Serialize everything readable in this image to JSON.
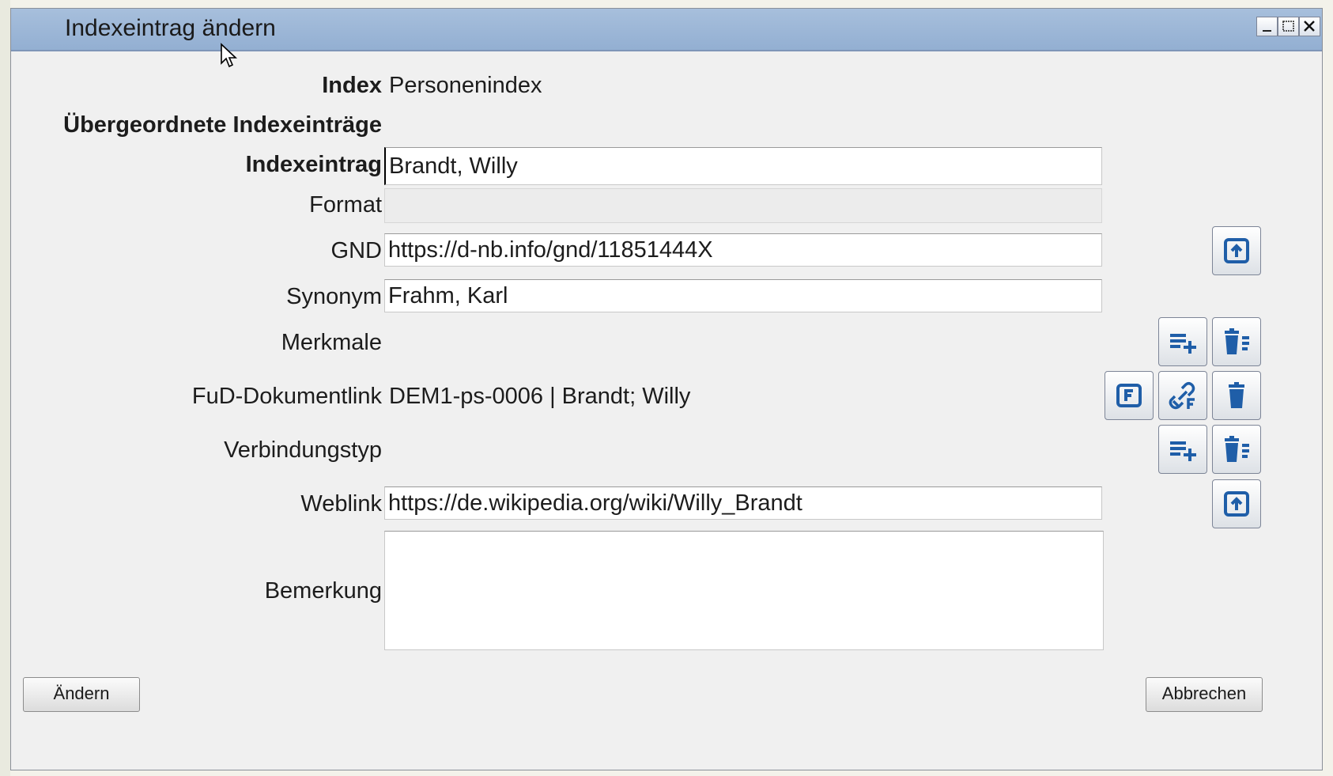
{
  "window": {
    "title": "Indexeintrag ändern"
  },
  "form": {
    "index": {
      "label": "Index",
      "value": "Personenindex"
    },
    "parent_heading": "Übergeordnete Indexeinträge",
    "entry": {
      "label": "Indexeintrag",
      "value": "Brandt, Willy"
    },
    "format": {
      "label": "Format",
      "value": ""
    },
    "gnd": {
      "label": "GND",
      "value": "https://d-nb.info/gnd/11851444X"
    },
    "synonym": {
      "label": "Synonym",
      "value": "Frahm, Karl"
    },
    "features": {
      "label": "Merkmale"
    },
    "fud_link": {
      "label": "FuD-Dokumentlink",
      "value": "DEM1-ps-0006 | Brandt; Willy"
    },
    "connection_type": {
      "label": "Verbindungstyp"
    },
    "weblink": {
      "label": "Weblink",
      "value": "https://de.wikipedia.org/wiki/Willy_Brandt"
    },
    "remark": {
      "label": "Bemerkung",
      "value": ""
    }
  },
  "buttons": {
    "change": "Ändern",
    "cancel": "Abbrechen"
  },
  "icons": {
    "open_link": "open-external-icon",
    "add_list": "list-add-icon",
    "delete_list": "list-delete-icon",
    "fud_document": "fud-document-icon",
    "fud_link": "link-f-icon",
    "trash": "trash-icon"
  },
  "colors": {
    "icon_blue": "#1f5ea8",
    "titlebar": "#9db6d6"
  }
}
